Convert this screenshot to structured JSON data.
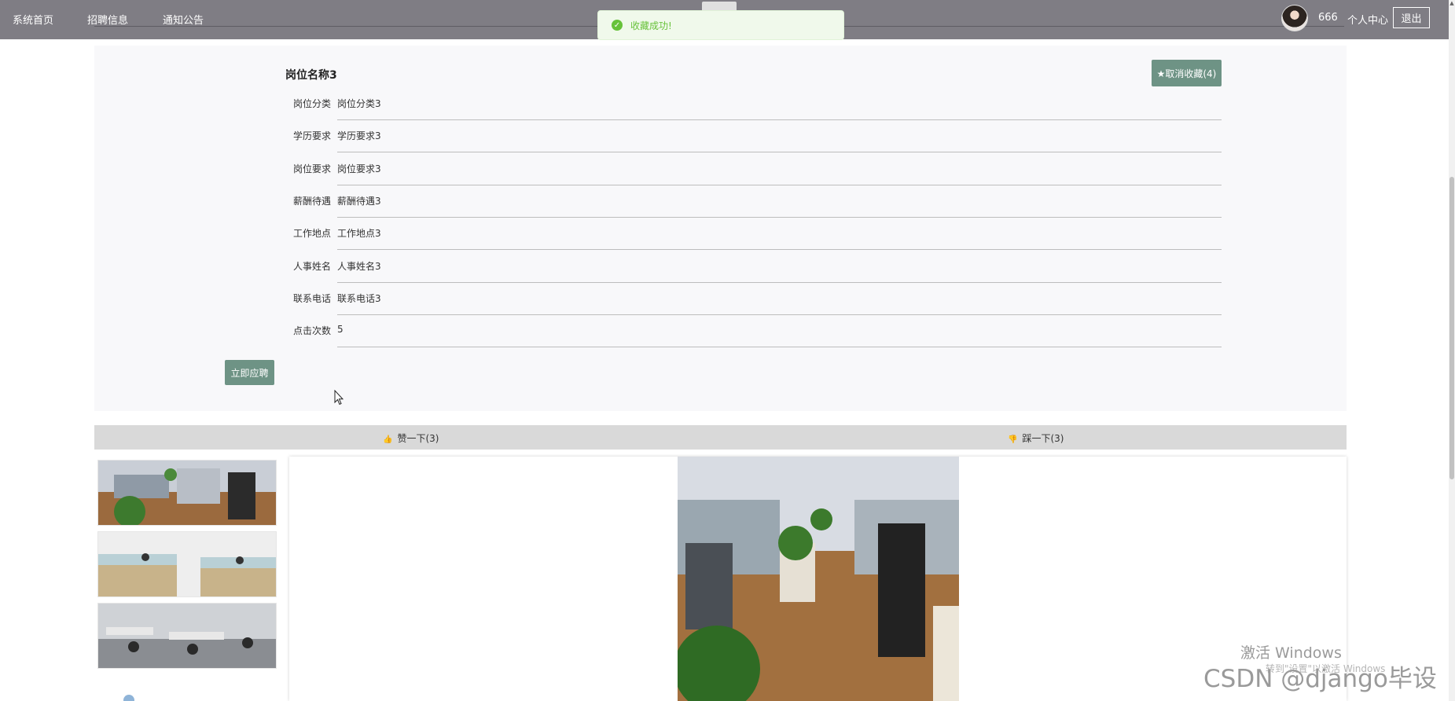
{
  "nav": {
    "items": [
      "系统首页",
      "招聘信息",
      "通知公告"
    ],
    "username": "666",
    "center_label": "个人中心",
    "logout_label": "退出"
  },
  "toast": {
    "message": "收藏成功!"
  },
  "job": {
    "title": "岗位名称3",
    "favorite_label": "★取消收藏(4)",
    "fields": [
      {
        "label": "岗位分类",
        "value": "岗位分类3"
      },
      {
        "label": "学历要求",
        "value": "学历要求3"
      },
      {
        "label": "岗位要求",
        "value": "岗位要求3"
      },
      {
        "label": "薪酬待遇",
        "value": "薪酬待遇3"
      },
      {
        "label": "工作地点",
        "value": "工作地点3"
      },
      {
        "label": "人事姓名",
        "value": "人事姓名3"
      },
      {
        "label": "联系电话",
        "value": "联系电话3"
      },
      {
        "label": "点击次数",
        "value": "5"
      }
    ],
    "apply_label": "立即应聘"
  },
  "reactions": {
    "like_label": "赞一下(3)",
    "dislike_label": "踩一下(3)"
  },
  "icons": {
    "toast": "check-circle-icon",
    "like": "thumbs-up-icon",
    "dislike": "thumbs-down-icon"
  },
  "colors": {
    "nav_bg": "#7f7d84",
    "accent": "#6e9385",
    "toast_green": "#67c23a"
  },
  "watermarks": {
    "windows": "激活 Windows",
    "windows_sub": "转到\"设置\"以激活 Windows",
    "csdn": "CSDN @django毕设"
  }
}
